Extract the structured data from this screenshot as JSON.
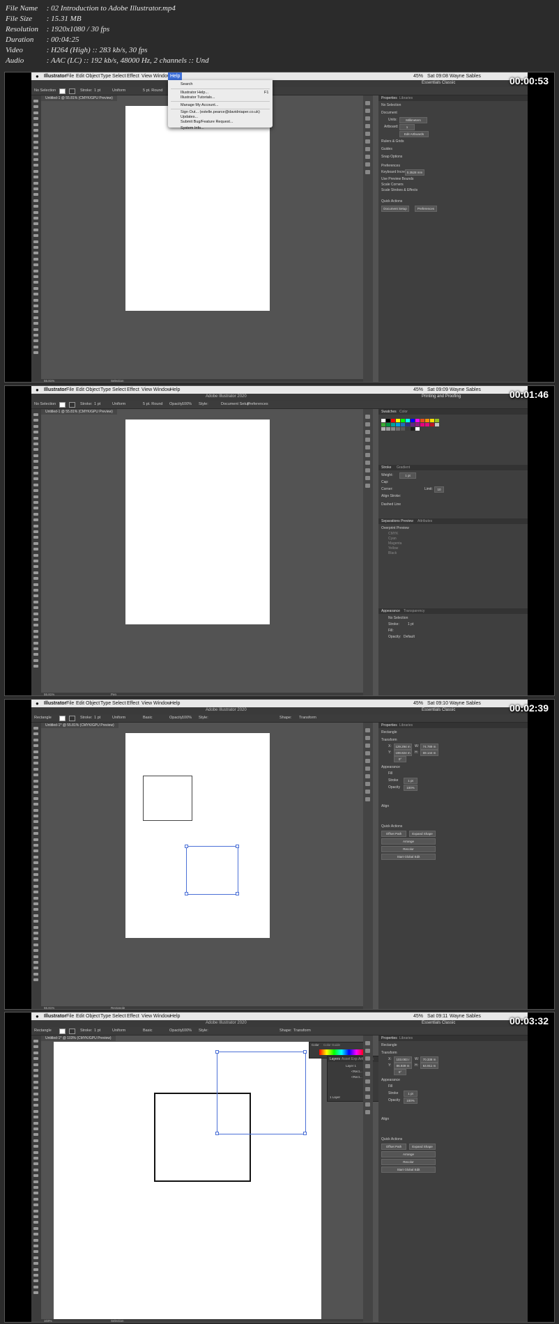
{
  "info": {
    "rows": [
      {
        "key": "File Name",
        "value": "02 Introduction to Adobe Illustrator.mp4"
      },
      {
        "key": "File Size",
        "value": "15.31 MB"
      },
      {
        "key": "Resolution",
        "value": "1920x1080 / 30 fps"
      },
      {
        "key": "Duration",
        "value": "00:04:25"
      },
      {
        "key": "Video",
        "value": "H264 (High) :: 283 kb/s, 30 fps"
      },
      {
        "key": "Audio",
        "value": "AAC (LC) :: 192 kb/s, 48000 Hz, 2 channels :: Und"
      }
    ],
    "separator": ":"
  },
  "macmenu": {
    "apple": "",
    "app": "Illustrator",
    "items": [
      "File",
      "Edit",
      "Object",
      "Type",
      "Select",
      "Effect",
      "View",
      "Window",
      "Help"
    ],
    "battery": "45%",
    "user": "Wayne Sables"
  },
  "frames": [
    {
      "timecode": "00:00:53",
      "clock": "Sat 09:08",
      "app_title": "",
      "workspace": "Essentials Classic",
      "doc_tab": "Untitled-1 @ 55.81% (CMYK/GPU Preview)",
      "control": {
        "selection": "No Selection",
        "stroke_label": "Stroke:",
        "stroke_value": "1 pt",
        "profile": "Uniform",
        "brush": "5 pt. Round",
        "opacity_label": "",
        "opacity_value": "",
        "style_label": ""
      },
      "help_menu": {
        "items": [
          "Search",
          "Illustrator Help...",
          "Illustrator Tutorials...",
          "Manage My Account...",
          "Sign Out... (estelle.pearce@davidniaper.co.uk)",
          "Updates...",
          "Submit Bug/Feature Request...",
          "System Info..."
        ],
        "shortcut": "F1"
      },
      "panel": {
        "tabs": [
          "Properties",
          "Libraries"
        ],
        "lines": [
          "No Selection",
          "Document",
          "Units:",
          "Millimeters",
          "Artboard:",
          "1",
          "Edit Artboards",
          "Rulers & Grids",
          "Guides",
          "Snap Options",
          "Preferences",
          "Keyboard Increment:",
          "0.3528 mm",
          "Use Preview Bounds",
          "Scale Corners",
          "Scale Strokes & Effects",
          "Quick Actions"
        ],
        "buttons": [
          "Document Setup",
          "Preferences"
        ]
      },
      "status": {
        "zoom": "55.81%",
        "tool": "Selection"
      }
    },
    {
      "timecode": "00:01:46",
      "clock": "Sat 09:09",
      "app_title": "Adobe Illustrator 2020",
      "workspace": "Printing and Proofing",
      "doc_tab": "Untitled-1 @ 55.81% (CMYK/GPU Preview)",
      "control": {
        "selection": "No Selection",
        "stroke_label": "Stroke:",
        "stroke_value": "1 pt",
        "profile": "Uniform",
        "brush": "5 pt. Round",
        "opacity_label": "Opacity:",
        "opacity_value": "100%",
        "style_label": "Style:",
        "buttons": [
          "Document Setup",
          "Preferences"
        ]
      },
      "panel": {
        "tabs": [
          "Swatches",
          "Color"
        ],
        "stroke_tabs": [
          "Stroke",
          "Gradient"
        ],
        "stroke_lines": [
          "Weight:",
          "1 pt",
          "Cap:",
          "Corner:",
          "Limit:",
          "10",
          "Align Stroke:",
          "Dashed Line"
        ],
        "sep_tabs": [
          "Separations Preview",
          "Attributes"
        ],
        "sep_lines": [
          "Overprint Preview",
          "CMYK",
          "Cyan",
          "Magenta",
          "Yellow",
          "Black"
        ],
        "app_tabs": [
          "Appearance",
          "Transparency"
        ],
        "app_lines": [
          "No Selection",
          "Stroke:",
          "1 pt",
          "Fill:",
          "Opacity:",
          "Default"
        ]
      },
      "status": {
        "zoom": "55.81%",
        "tool": "Pen"
      }
    },
    {
      "timecode": "00:02:39",
      "clock": "Sat 09:10",
      "app_title": "Adobe Illustrator 2020",
      "workspace": "Essentials Classic",
      "doc_tab": "Untitled-1* @ 55.81% (CMYK/GPU Preview)",
      "control": {
        "selection": "Rectangle",
        "stroke_label": "Stroke:",
        "stroke_value": "1 pt",
        "profile": "Uniform",
        "brush": "Basic",
        "opacity_label": "Opacity:",
        "opacity_value": "100%",
        "style_label": "Style:",
        "extra": [
          "Shape:",
          "Transform"
        ]
      },
      "panel": {
        "tabs": [
          "Properties",
          "Libraries"
        ],
        "lines": [
          "Rectangle",
          "Transform",
          "X:",
          "129.294 m",
          "W:",
          "74.789 m",
          "Y:",
          "198.824 m",
          "H:",
          "69.144 m",
          "0°",
          "Appearance",
          "Fill",
          "Stroke",
          "1 pt",
          "Opacity",
          "100%",
          "Align",
          "Quick Actions"
        ],
        "buttons": [
          "Offset Path",
          "Expand Shape",
          "Arrange",
          "Recolor",
          "Start Global Edit"
        ]
      },
      "status": {
        "zoom": "55.81%",
        "tool": "Rectangle"
      }
    },
    {
      "timecode": "00:03:32",
      "clock": "Sat 09:11",
      "app_title": "Adobe Illustrator 2020",
      "workspace": "Essentials Classic",
      "doc_tab": "Untitled-1* @ 103% (CMYK/GPU Preview)",
      "control": {
        "selection": "Rectangle",
        "stroke_label": "Stroke:",
        "stroke_value": "1 pt",
        "profile": "Uniform",
        "brush": "Basic",
        "opacity_label": "Opacity:",
        "opacity_value": "100%",
        "style_label": "Style:",
        "extra": [
          "Shape:",
          "Transform"
        ]
      },
      "color_panel": {
        "tabs": [
          "Color",
          "Color Guide"
        ]
      },
      "layers_panel": {
        "tabs": [
          "Layers",
          "Asset Exp.",
          "Artboards"
        ],
        "rows": [
          "Layer 1",
          "<Rect...",
          "<Rect..."
        ],
        "footer": "1 Layer"
      },
      "panel": {
        "tabs": [
          "Properties",
          "Libraries"
        ],
        "lines": [
          "Rectangle",
          "Transform",
          "X:",
          "103.083 r",
          "W:",
          "70.338 m",
          "Y:",
          "86.939 m",
          "H:",
          "64.911 m",
          "0°",
          "Appearance",
          "Fill",
          "Stroke",
          "1 pt",
          "Opacity",
          "100%",
          "Align",
          "Quick Actions"
        ],
        "buttons": [
          "Offset Path",
          "Expand Shape",
          "Arrange",
          "Recolor",
          "Start Global Edit"
        ]
      },
      "status": {
        "zoom": "103%",
        "tool": "Selection"
      }
    }
  ],
  "colors": {
    "help_highlight": "#3d6fd9",
    "selection": "#4a6fd6",
    "panel_bg": "#3f3f3f",
    "canvas_bg": "#535353"
  }
}
